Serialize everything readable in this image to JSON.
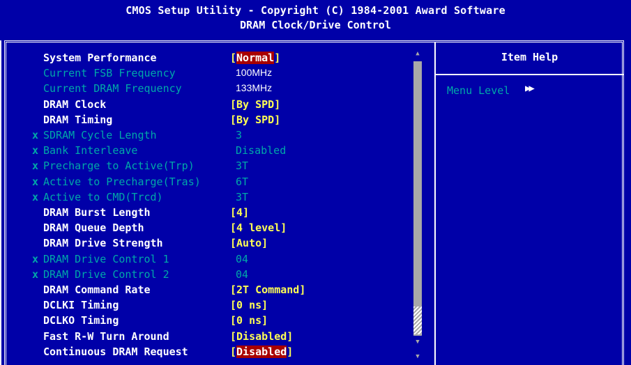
{
  "header": {
    "title": "CMOS Setup Utility - Copyright (C) 1984-2001 Award Software",
    "subtitle": "DRAM Clock/Drive Control"
  },
  "help": {
    "title": "Item Help",
    "menu_level_label": "Menu Level",
    "menu_level_icon": "▶▶"
  },
  "settings": [
    {
      "label": "System Performance",
      "value": "Normal",
      "state": "active",
      "bracket": true,
      "highlight": true,
      "x": false
    },
    {
      "label": "Current FSB Frequency",
      "value": "100MHz",
      "state": "info",
      "bracket": false,
      "highlight": false,
      "x": false
    },
    {
      "label": "Current DRAM Frequency",
      "value": "133MHz",
      "state": "info",
      "bracket": false,
      "highlight": false,
      "x": false
    },
    {
      "label": "DRAM Clock",
      "value": "By SPD",
      "state": "active",
      "bracket": true,
      "highlight": false,
      "x": false
    },
    {
      "label": "DRAM Timing",
      "value": "By SPD",
      "state": "active",
      "bracket": true,
      "highlight": false,
      "x": false
    },
    {
      "label": "SDRAM Cycle Length",
      "value": "3",
      "state": "disabled",
      "bracket": false,
      "highlight": false,
      "x": true
    },
    {
      "label": "Bank Interleave",
      "value": "Disabled",
      "state": "disabled",
      "bracket": false,
      "highlight": false,
      "x": true
    },
    {
      "label": "Precharge to Active(Trp)",
      "value": "3T",
      "state": "disabled",
      "bracket": false,
      "highlight": false,
      "x": true
    },
    {
      "label": "Active to Precharge(Tras)",
      "value": "6T",
      "state": "disabled",
      "bracket": false,
      "highlight": false,
      "x": true
    },
    {
      "label": "Active to CMD(Trcd)",
      "value": "3T",
      "state": "disabled",
      "bracket": false,
      "highlight": false,
      "x": true
    },
    {
      "label": "DRAM Burst Length",
      "value": "4",
      "state": "active",
      "bracket": true,
      "highlight": false,
      "x": false
    },
    {
      "label": "DRAM Queue Depth",
      "value": "4 level",
      "state": "active",
      "bracket": true,
      "highlight": false,
      "x": false
    },
    {
      "label": "DRAM Drive Strength",
      "value": "Auto",
      "state": "active",
      "bracket": true,
      "highlight": false,
      "x": false
    },
    {
      "label": "DRAM Drive Control 1",
      "value": "04",
      "state": "disabled",
      "bracket": false,
      "highlight": false,
      "x": true
    },
    {
      "label": "DRAM Drive Control 2",
      "value": "04",
      "state": "disabled",
      "bracket": false,
      "highlight": false,
      "x": true
    },
    {
      "label": "DRAM Command Rate",
      "value": "2T Command",
      "state": "active",
      "bracket": true,
      "highlight": false,
      "x": false
    },
    {
      "label": "DCLKI Timing",
      "value": "0 ns",
      "state": "active",
      "bracket": true,
      "highlight": false,
      "x": false
    },
    {
      "label": "DCLKO Timing",
      "value": "0 ns",
      "state": "active",
      "bracket": true,
      "highlight": false,
      "x": false
    },
    {
      "label": "Fast R-W Turn Around",
      "value": "Disabled",
      "state": "active",
      "bracket": true,
      "highlight": false,
      "x": false
    },
    {
      "label": "Continuous DRAM Request",
      "value": "Disabled",
      "state": "active",
      "bracket": true,
      "highlight": true,
      "x": false
    }
  ],
  "disabled_marker": "x",
  "colors": {
    "background": "#0000a8",
    "value": "#ffff54",
    "disabled": "#00a8a8",
    "highlight": "#a80000"
  }
}
